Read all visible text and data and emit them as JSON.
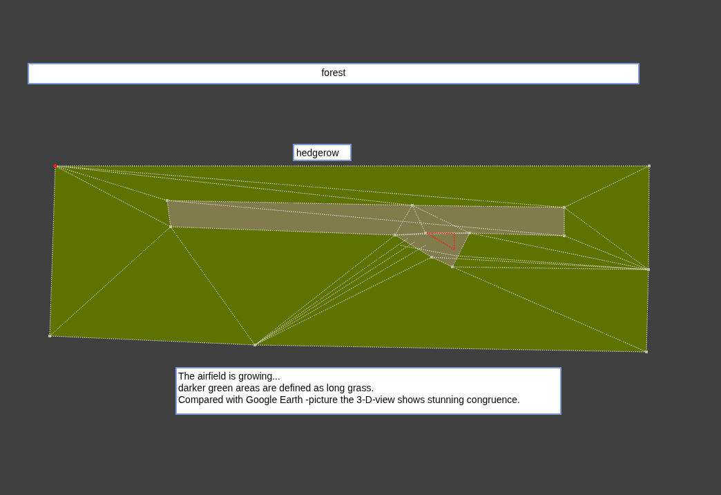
{
  "forest_label": "forest",
  "hedgerow_label": "hedgerow",
  "note": {
    "lines": [
      "The airfield is growing...",
      "darker green areas are defined as long grass.",
      "Compared with Google Earth -picture the 3-D-view shows stunning congruence."
    ]
  }
}
